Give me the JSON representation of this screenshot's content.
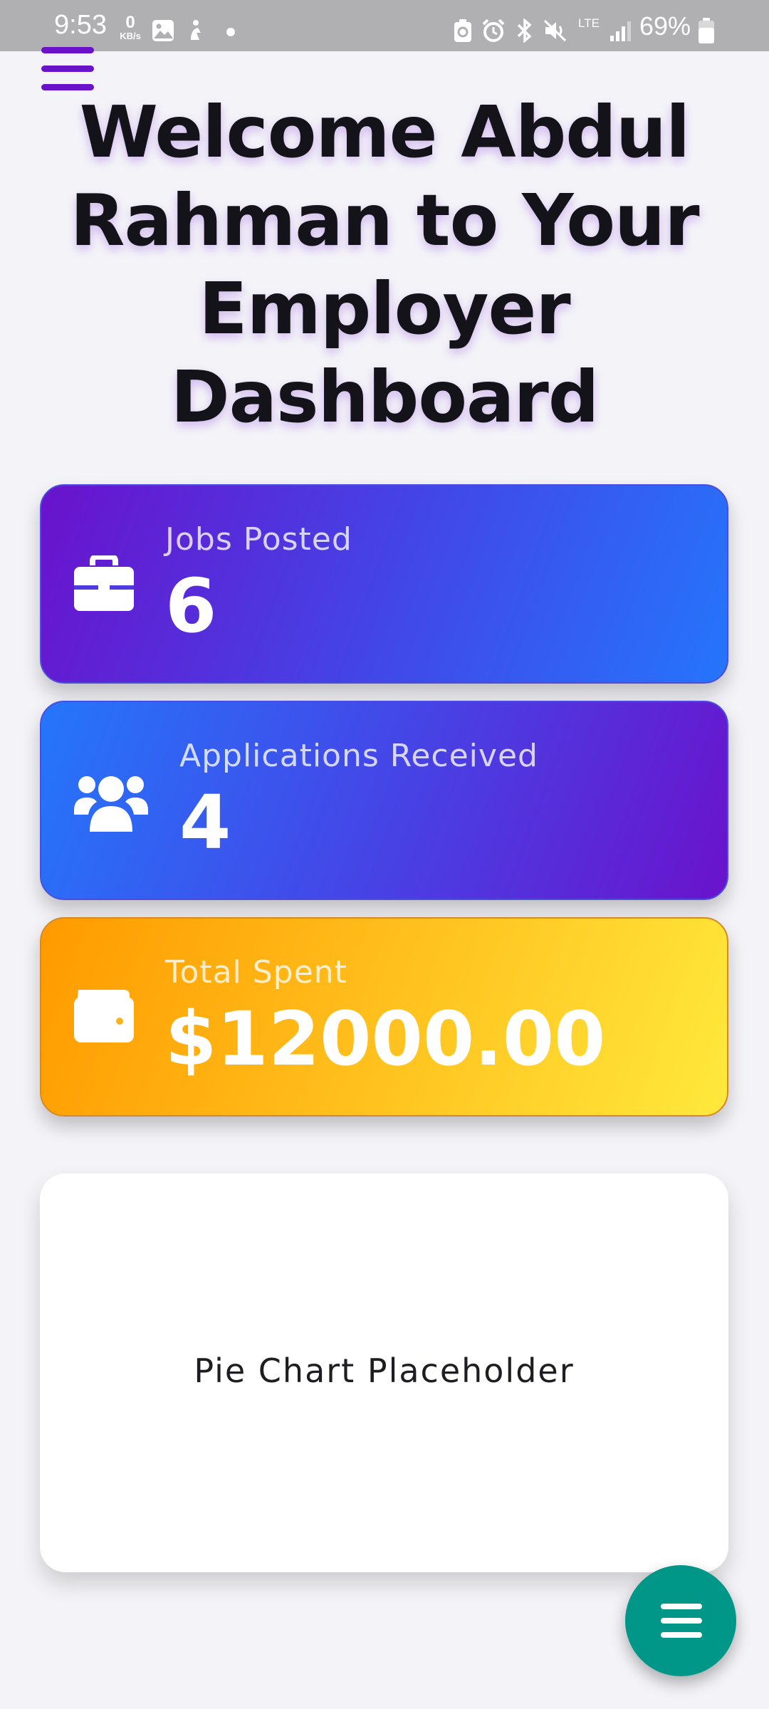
{
  "status_bar": {
    "time": "9:53",
    "speed_value": "0",
    "speed_unit": "KB/s",
    "network": "LTE",
    "battery_percent": "69%"
  },
  "header": {
    "menu_icon": "hamburger-menu-icon",
    "title": "Welcome Abdul Rahman to Your Employer Dashboard"
  },
  "stats": {
    "jobs_posted": {
      "label": "Jobs Posted",
      "value": "6",
      "icon": "briefcase-icon"
    },
    "applications": {
      "label": "Applications Received",
      "value": "4",
      "icon": "users-icon"
    },
    "total_spent": {
      "label": "Total Spent",
      "value": "$12000.00",
      "icon": "wallet-icon"
    }
  },
  "chart_panel": {
    "placeholder": "Pie Chart Placeholder"
  },
  "fab": {
    "icon": "menu-icon"
  },
  "colors": {
    "accent_purple": "#6a12c9",
    "accent_blue": "#2575fb",
    "accent_orange": "#ff9a00",
    "accent_yellow": "#ffe93c",
    "fab_teal": "#009688"
  }
}
